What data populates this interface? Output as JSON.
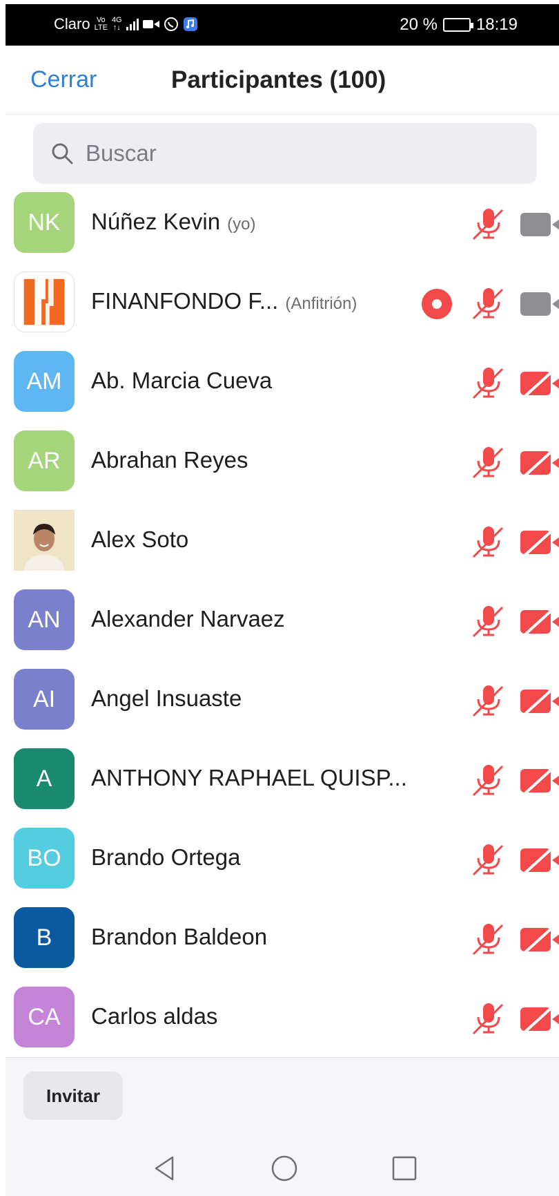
{
  "status_bar": {
    "carrier": "Claro",
    "volte_top": "Vo",
    "volte_bottom": "LTE",
    "network_top": "4G",
    "network_bottom": "↑↓",
    "battery": "20 %",
    "time": "18:19"
  },
  "header": {
    "close_label": "Cerrar",
    "title": "Participantes (100)"
  },
  "search": {
    "placeholder": "Buscar"
  },
  "colors": {
    "accent_blue": "#2f7fd3",
    "muted_red": "#f2494b",
    "camera_gray": "#8e8e93"
  },
  "participants": [
    {
      "initials": "NK",
      "name": "Núñez Kevin",
      "role": "(yo)",
      "avatar_color": "#a5d57b",
      "mic_muted": true,
      "video": "off-gray"
    },
    {
      "initials": "",
      "name": "FINANFONDO F...",
      "role": "(Anfitrión)",
      "avatar_color": "#ffffff",
      "mic_muted": true,
      "video": "off-gray",
      "recording": true,
      "logo": true
    },
    {
      "initials": "AM",
      "name": "Ab. Marcia Cueva",
      "role": "",
      "avatar_color": "#5eb6f2",
      "mic_muted": true,
      "video": "off-red"
    },
    {
      "initials": "AR",
      "name": "Abrahan Reyes",
      "role": "",
      "avatar_color": "#a5d57b",
      "mic_muted": true,
      "video": "off-red"
    },
    {
      "initials": "",
      "name": "Alex Soto",
      "role": "",
      "avatar_color": "#e9dcc4",
      "mic_muted": true,
      "video": "off-red",
      "photo": true
    },
    {
      "initials": "AN",
      "name": "Alexander Narvaez",
      "role": "",
      "avatar_color": "#7b80cc",
      "mic_muted": true,
      "video": "off-red"
    },
    {
      "initials": "AI",
      "name": "Angel Insuaste",
      "role": "",
      "avatar_color": "#7b80cc",
      "mic_muted": true,
      "video": "off-red"
    },
    {
      "initials": "A",
      "name": "ANTHONY RAPHAEL QUISP...",
      "role": "",
      "avatar_color": "#1a8a6f",
      "mic_muted": true,
      "video": "off-red"
    },
    {
      "initials": "BO",
      "name": "Brando Ortega",
      "role": "",
      "avatar_color": "#55cde0",
      "mic_muted": true,
      "video": "off-red"
    },
    {
      "initials": "B",
      "name": "Brandon Baldeon",
      "role": "",
      "avatar_color": "#0b5aa0",
      "mic_muted": true,
      "video": "off-red"
    },
    {
      "initials": "CA",
      "name": "Carlos aldas",
      "role": "",
      "avatar_color": "#c684d8",
      "mic_muted": true,
      "video": "off-red"
    }
  ],
  "footer": {
    "invite_label": "Invitar"
  }
}
